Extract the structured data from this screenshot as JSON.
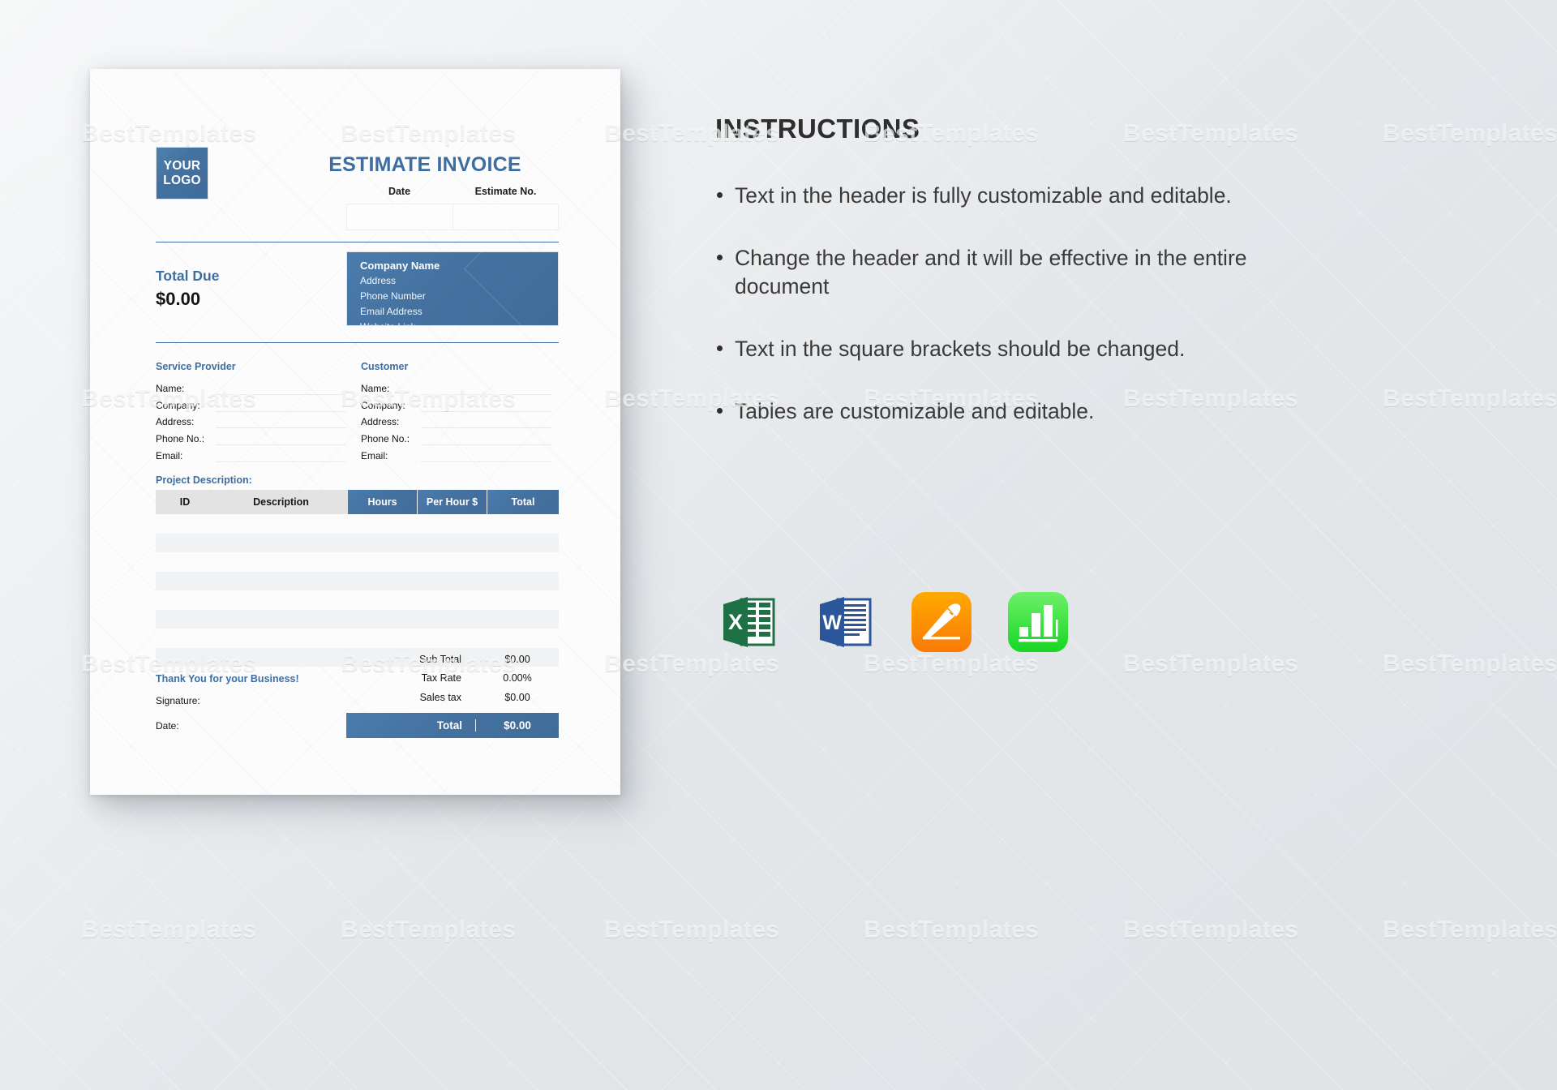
{
  "colors": {
    "accent_blue": "#44719f",
    "title_blue": "#3d6ea3",
    "page_background": "#e4e7ea",
    "paper": "#fcfcfc",
    "table_header_grey": "#e3e3e3",
    "row_band": "#f1f2f3",
    "excel_green": "#1e7145",
    "word_blue": "#2b579a",
    "pages_orange": "#ff9500",
    "numbers_green": "#35d54a"
  },
  "watermark": {
    "text": "BestTemplates"
  },
  "document": {
    "logo": {
      "line1": "YOUR",
      "line2": "LOGO"
    },
    "title": "ESTIMATE INVOICE",
    "meta": {
      "headers": [
        "Date",
        "Estimate No."
      ],
      "values": [
        "",
        ""
      ]
    },
    "total_due": {
      "label": "Total Due",
      "value": "$0.00"
    },
    "company": {
      "name": "Company Name",
      "lines": [
        "Address",
        "Phone Number",
        "Email Address",
        "Website Link"
      ]
    },
    "parties": [
      {
        "heading": "Service Provider",
        "fields": [
          {
            "label": "Name:",
            "value": ""
          },
          {
            "label": "Company:",
            "value": ""
          },
          {
            "label": "Address:",
            "value": ""
          },
          {
            "label": "Phone No.:",
            "value": ""
          },
          {
            "label": "Email:",
            "value": ""
          }
        ]
      },
      {
        "heading": "Customer",
        "fields": [
          {
            "label": "Name:",
            "value": ""
          },
          {
            "label": "Company:",
            "value": ""
          },
          {
            "label": "Address:",
            "value": ""
          },
          {
            "label": "Phone No.:",
            "value": ""
          },
          {
            "label": "Email:",
            "value": ""
          }
        ]
      }
    ],
    "project": {
      "label": "Project Description:",
      "columns": [
        "ID",
        "Description",
        "Hours",
        "Per Hour $",
        "Total"
      ],
      "rows": [
        {
          "id": "",
          "description": "",
          "hours": "",
          "per_hour": "",
          "total": ""
        },
        {
          "id": "",
          "description": "",
          "hours": "",
          "per_hour": "",
          "total": ""
        },
        {
          "id": "",
          "description": "",
          "hours": "",
          "per_hour": "",
          "total": ""
        },
        {
          "id": "",
          "description": "",
          "hours": "",
          "per_hour": "",
          "total": ""
        },
        {
          "id": "",
          "description": "",
          "hours": "",
          "per_hour": "",
          "total": ""
        },
        {
          "id": "",
          "description": "",
          "hours": "",
          "per_hour": "",
          "total": ""
        },
        {
          "id": "",
          "description": "",
          "hours": "",
          "per_hour": "",
          "total": ""
        },
        {
          "id": "",
          "description": "",
          "hours": "",
          "per_hour": "",
          "total": ""
        }
      ]
    },
    "totals": [
      {
        "label": "Sub Total",
        "value": "$0.00"
      },
      {
        "label": "Tax Rate",
        "value": "0.00%"
      },
      {
        "label": "Sales tax",
        "value": "$0.00"
      }
    ],
    "grand_total": {
      "label": "Total",
      "value": "$0.00"
    },
    "footer": {
      "thanks": "Thank You for your Business!",
      "signature_label": "Signature:",
      "date_label": "Date:"
    }
  },
  "instructions": {
    "title": "INSTRUCTIONS",
    "items": [
      "Text in the header is fully customizable and editable.",
      "Change the header and it will be effective in the entire document",
      "Text in the square brackets should be changed.",
      "Tables are customizable and editable."
    ]
  },
  "app_icons": [
    {
      "name": "microsoft-excel-icon",
      "letter": "X",
      "label": "Microsoft Excel"
    },
    {
      "name": "microsoft-word-icon",
      "letter": "W",
      "label": "Microsoft Word"
    },
    {
      "name": "apple-pages-icon",
      "letter": "",
      "label": "Apple Pages"
    },
    {
      "name": "apple-numbers-icon",
      "letter": "",
      "label": "Apple Numbers"
    }
  ]
}
